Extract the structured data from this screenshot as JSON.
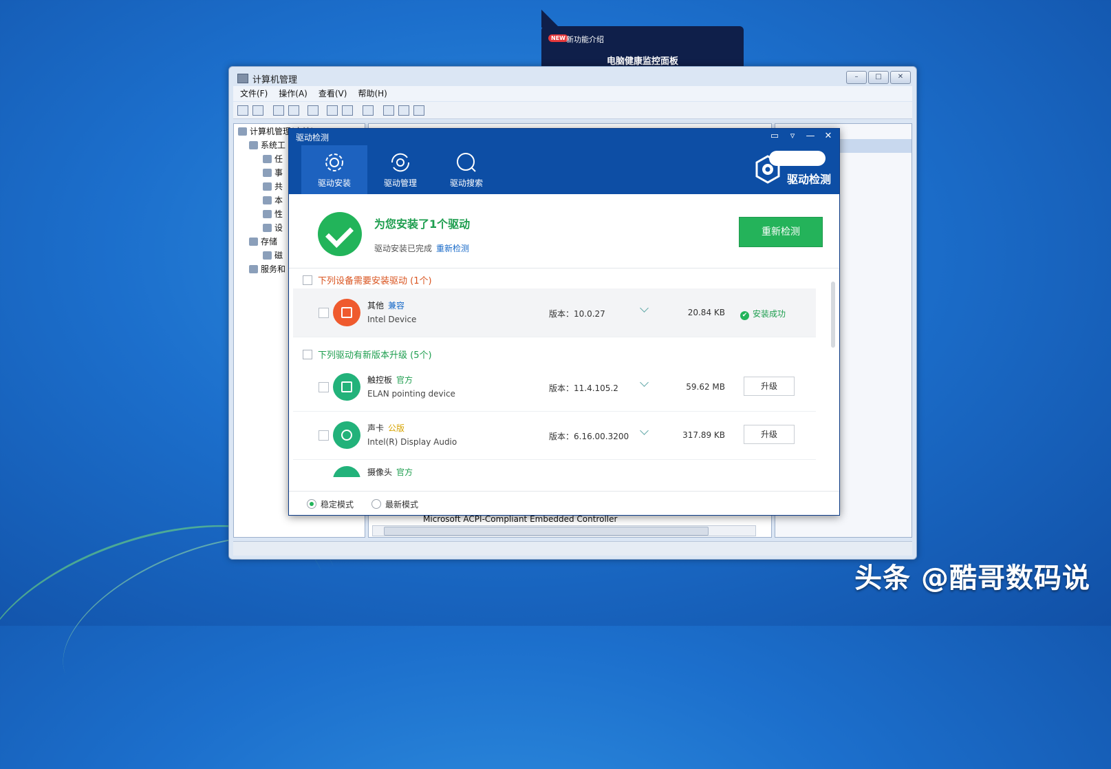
{
  "watermark": "头条 @酷哥数码说",
  "popup": {
    "new_badge": "NEW",
    "new_text": "新功能介绍",
    "title": "电脑健康监控面板"
  },
  "computer_management": {
    "title": "计算机管理",
    "window_buttons": [
      "–",
      "□",
      "✕"
    ],
    "menu": [
      "文件(F)",
      "操作(A)",
      "查看(V)",
      "帮助(H)"
    ],
    "tree": [
      "计算机管理(本地)",
      "系统工",
      "任",
      "事",
      "共",
      "本",
      "性",
      "设",
      "存储",
      "磁",
      "服务和"
    ],
    "device_row": "Microsoft ACPI-Compliant Embedded Controller",
    "scroll_label": "III"
  },
  "driver_window": {
    "title": "驱动检测",
    "controls": [
      "▭",
      "▿",
      "—",
      "✕"
    ],
    "tabs": [
      {
        "label": "驱动安装",
        "icon": "gear-icon"
      },
      {
        "label": "驱动管理",
        "icon": "refresh-icon"
      },
      {
        "label": "驱动搜索",
        "icon": "search-icon"
      }
    ],
    "brand": "驱动检测",
    "result": {
      "title": "为您安装了1个驱动",
      "subtitle": "驱动安装已完成",
      "link": "重新检测",
      "button": "重新检测"
    },
    "section_install": "下列设备需要安装驱动 (1个)",
    "section_upgrade": "下列驱动有新版本升级 (5个)",
    "install_rows": [
      {
        "category": "其他",
        "tag": "兼容",
        "device": "Intel Device",
        "version": "版本：10.0.27",
        "size": "20.84 KB",
        "status": "安装成功"
      }
    ],
    "upgrade_rows": [
      {
        "category": "触控板",
        "tag": "官方",
        "device": "ELAN pointing device",
        "version": "版本：11.4.105.2",
        "size": "59.62 MB",
        "action": "升级"
      },
      {
        "category": "声卡",
        "tag": "公版",
        "device": "Intel(R) Display Audio",
        "version": "版本：6.16.00.3200",
        "size": "317.89 KB",
        "action": "升级"
      },
      {
        "category": "摄像头",
        "tag": "官方"
      }
    ],
    "modes": {
      "stable": "稳定模式",
      "latest": "最新模式",
      "selected": "stable"
    }
  }
}
